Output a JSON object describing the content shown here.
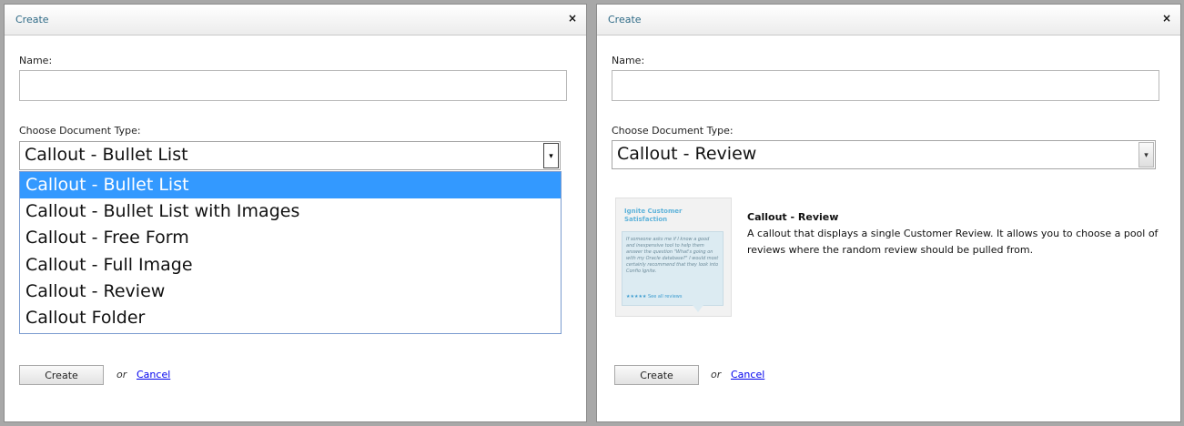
{
  "left_dialog": {
    "title": "Create",
    "close_glyph": "×",
    "name_label": "Name:",
    "name_value": "",
    "doctype_label": "Choose Document Type:",
    "doctype_selected": "Callout - Bullet List",
    "dropdown_arrow": "▾",
    "dropdown_open": true,
    "dropdown_options": [
      "Callout - Bullet List",
      "Callout - Bullet List with Images",
      "Callout - Free Form",
      "Callout - Full Image",
      "Callout - Review",
      "Callout Folder"
    ],
    "dropdown_highlighted_index": 0,
    "create_button": "Create",
    "or_text": "or",
    "cancel_link": "Cancel"
  },
  "right_dialog": {
    "title": "Create",
    "close_glyph": "×",
    "name_label": "Name:",
    "name_value": "",
    "doctype_label": "Choose Document Type:",
    "doctype_selected": "Callout - Review",
    "dropdown_arrow": "▾",
    "preview": {
      "thumb_title": "Ignite Customer Satisfaction",
      "thumb_quote": "If someone asks me if I know a good and inexpensive tool to help them answer the question \"What's going on with my Oracle database?\" I would most certainly recommend that they look into Confio Ignite.",
      "thumb_rating": "★★★★★  See all reviews",
      "description_title": "Callout - Review",
      "description_body": "A callout that displays a single Customer Review. It allows you to choose a pool of reviews where the random review should be pulled from."
    },
    "create_button": "Create",
    "or_text": "or",
    "cancel_link": "Cancel"
  },
  "colors": {
    "title_text": "#2e6a86",
    "highlight": "#3399ff",
    "link": "#0000ee",
    "backdrop": "#a8a8a8"
  }
}
